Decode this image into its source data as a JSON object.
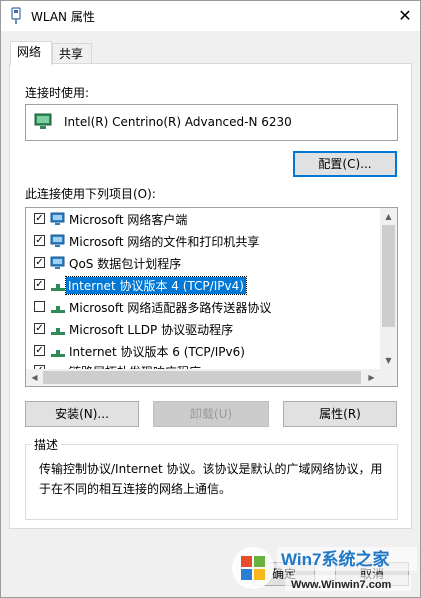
{
  "window": {
    "title": "WLAN 属性",
    "close_glyph": "✕"
  },
  "tabs": [
    {
      "label": "网络"
    },
    {
      "label": "共享"
    }
  ],
  "connect_using": {
    "label": "连接时使用:",
    "adapter": "Intel(R) Centrino(R) Advanced-N 6230",
    "configure_button": "配置(C)..."
  },
  "items_section": {
    "label": "此连接使用下列项目(O):",
    "items": [
      {
        "label": "Microsoft 网络客户端",
        "checked": true,
        "icon": "network-client-icon"
      },
      {
        "label": "Microsoft 网络的文件和打印机共享",
        "checked": true,
        "icon": "network-client-icon"
      },
      {
        "label": "QoS 数据包计划程序",
        "checked": true,
        "icon": "network-client-icon"
      },
      {
        "label": "Internet 协议版本 4 (TCP/IPv4)",
        "checked": true,
        "icon": "protocol-icon",
        "selected": true
      },
      {
        "label": "Microsoft 网络适配器多路传送器协议",
        "checked": false,
        "icon": "protocol-icon"
      },
      {
        "label": "Microsoft LLDP 协议驱动程序",
        "checked": true,
        "icon": "protocol-icon"
      },
      {
        "label": "Internet 协议版本 6 (TCP/IPv6)",
        "checked": true,
        "icon": "protocol-icon"
      },
      {
        "label": "链路层拓扑发现响应程序",
        "checked": true,
        "icon": "protocol-icon"
      }
    ]
  },
  "buttons": {
    "install": "安装(N)...",
    "uninstall": "卸载(U)",
    "properties": "属性(R)"
  },
  "description": {
    "legend": "描述",
    "text": "传输控制协议/Internet 协议。该协议是默认的广域网络协议，用于在不同的相互连接的网络上通信。"
  },
  "footer": {
    "ok_button": "确定",
    "cancel_button": "取消"
  },
  "watermark": {
    "brand": "Win7系统之家",
    "url": "Www.Winwin7.com"
  },
  "colors": {
    "selection": "#0078d7",
    "focus_border": "#0078d7"
  }
}
